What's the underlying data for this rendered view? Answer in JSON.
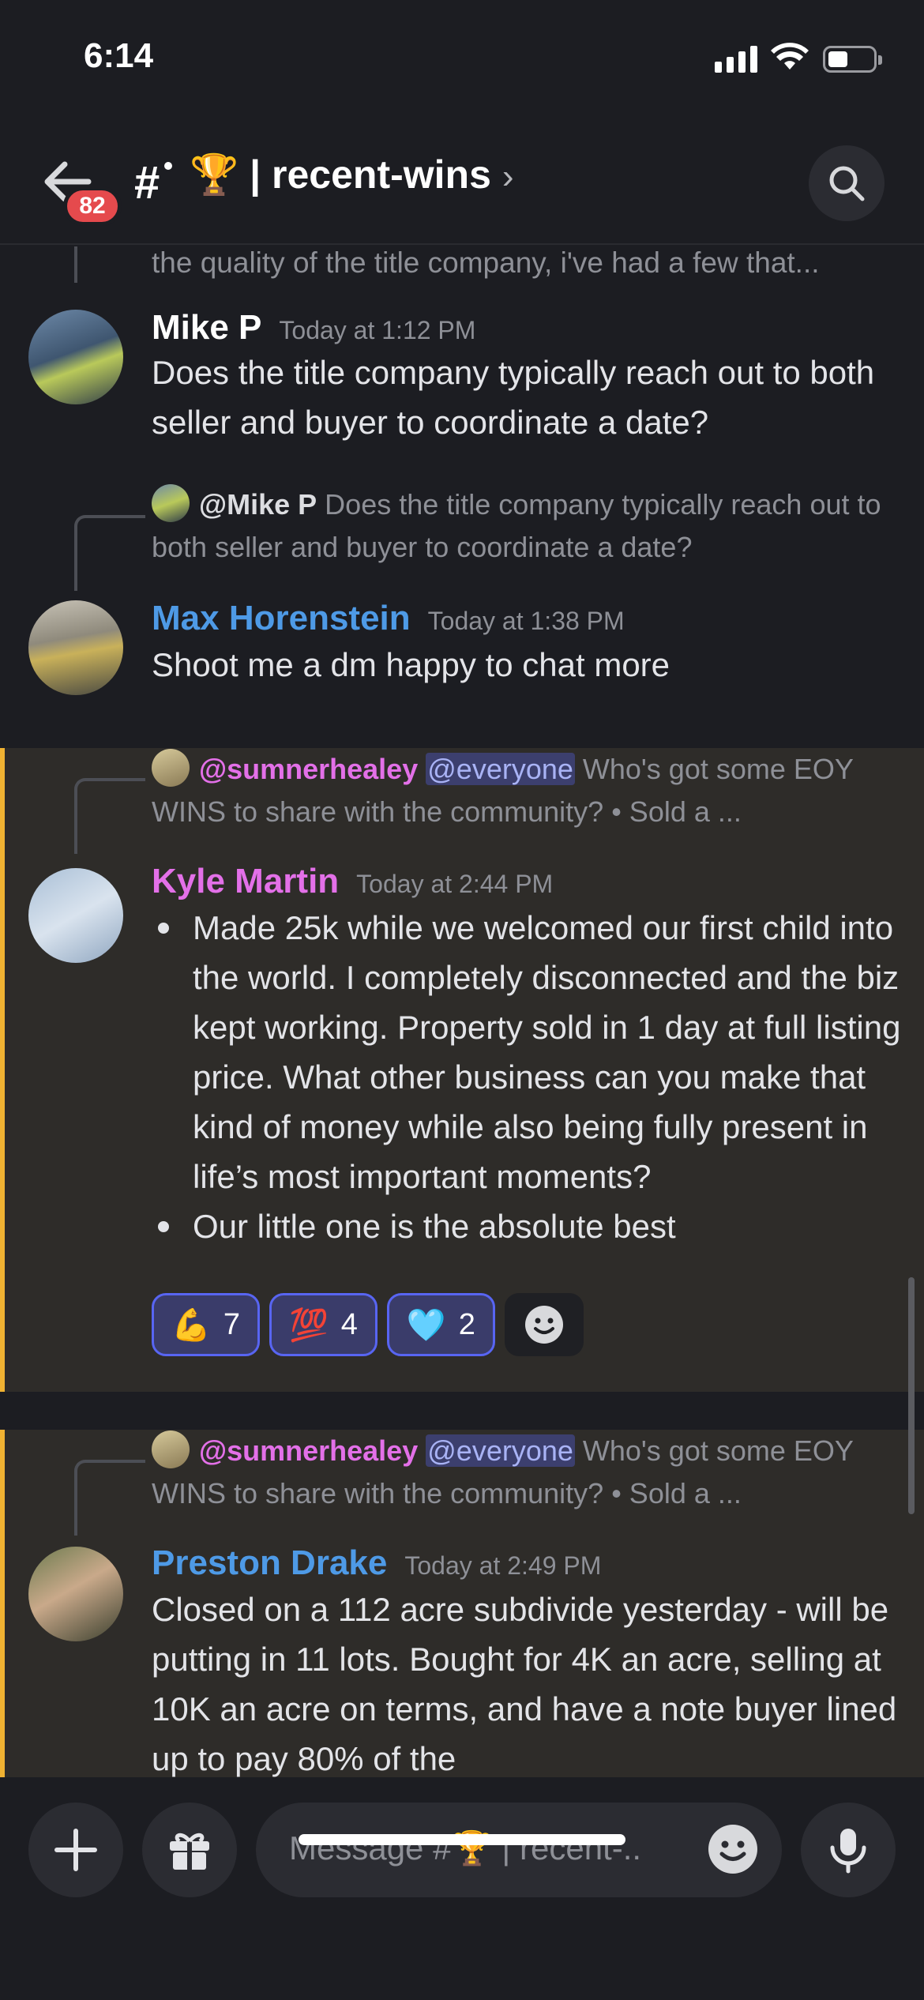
{
  "status_bar": {
    "time": "6:14"
  },
  "header": {
    "unread_badge": "82",
    "channel_name": "🏆 | recent-wins",
    "chevron": "›"
  },
  "messages": {
    "prev_snippet": "the quality of the title company, i've had a few that...",
    "mike": {
      "author": "Mike P",
      "time": "Today at 1:12 PM",
      "text": "Does the title company typically reach out to both seller and buyer to coordinate a date?"
    },
    "max": {
      "reply_author": "@Mike P",
      "reply_text": "Does the title company typically reach out to both seller and buyer to coordinate a date?",
      "author": "Max Horenstein",
      "time": "Today at 1:38 PM",
      "text": "Shoot me a dm happy to chat more"
    },
    "kyle": {
      "reply_author": "@sumnerhealey",
      "reply_mention": "@everyone",
      "reply_text": "Who's got some EOY WINS to share with the community? • Sold a ...",
      "author": "Kyle Martin",
      "time": "Today at 2:44 PM",
      "bullets": [
        "Made 25k while we welcomed our first child into the world. I completely disconnected and the biz kept working. Property sold in 1 day at full listing price. What other business can you make that kind of money while also being fully present in life’s most important moments?",
        "Our little one is the absolute best"
      ],
      "reactions": [
        {
          "emoji": "💪",
          "count": "7"
        },
        {
          "emoji": "💯",
          "count": "4"
        },
        {
          "emoji": "🩵",
          "count": "2"
        }
      ]
    },
    "preston": {
      "reply_author": "@sumnerhealey",
      "reply_mention": "@everyone",
      "reply_text": "Who's got some EOY WINS to share with the community? • Sold a ...",
      "author": "Preston Drake",
      "time": "Today at 2:49 PM",
      "text": "Closed on a 112 acre subdivide yesterday - will be putting in 11 lots.  Bought for 4K an acre, selling at 10K an acre on terms, and have a note buyer lined up to pay 80% of the"
    }
  },
  "composer": {
    "placeholder": "Message #🏆 | recent-.."
  },
  "colors": {
    "accent": "#5865f2",
    "highlight_bar": "#f0b232",
    "mention_blue": "#4e9ae6",
    "mention_pink": "#e370e8"
  }
}
